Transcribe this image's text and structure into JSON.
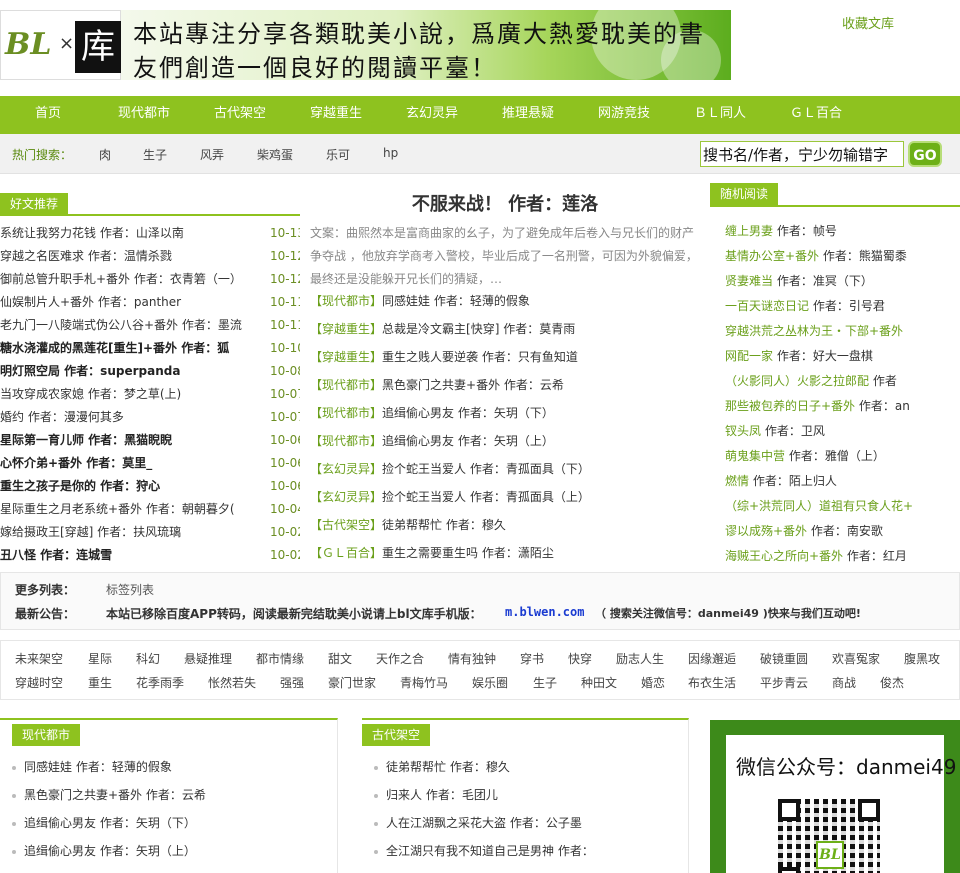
{
  "header": {
    "logo_text": "BL",
    "logo_x": "×",
    "logo_ku": "库",
    "banner_line1": "本站專注分享各類耽美小說，爲廣大熱愛耽美的書",
    "banner_line2": "友們創造一個良好的閱讀平臺！",
    "favorite": "收藏文库"
  },
  "nav": [
    "首页",
    "现代都市",
    "古代架空",
    "穿越重生",
    "玄幻灵异",
    "推理悬疑",
    "网游竞技",
    "ＢＬ同人",
    "ＧＬ百合"
  ],
  "hot_search": {
    "label": "热门搜索：",
    "keywords": [
      "肉",
      "生子",
      "风弄",
      "柴鸡蛋",
      "乐可",
      "hp"
    ]
  },
  "search": {
    "value": "搜书名/作者，宁少勿输错字",
    "button": "GO"
  },
  "left": {
    "tab": "好文推荐",
    "rows": [
      {
        "t": "系统让我努力花钱  作者：山泽以南",
        "d": "10-13",
        "b": false
      },
      {
        "t": "穿越之名医难求  作者：温情杀戮",
        "d": "10-12",
        "b": false
      },
      {
        "t": "御前总管升职手札+番外  作者：衣青箬（一）",
        "d": "10-12",
        "b": false
      },
      {
        "t": "仙娱制片人+番外  作者：panther",
        "d": "10-11",
        "b": false
      },
      {
        "t": "老九门一八陵端式伪公八谷+番外  作者：墨流",
        "d": "10-11",
        "b": false
      },
      {
        "t": "糖水浇灌成的黑莲花[重生]+番外  作者：狐",
        "d": "10-10",
        "b": true
      },
      {
        "t": "明灯照空局  作者：superpanda",
        "d": "10-08",
        "b": true
      },
      {
        "t": "当攻穿成农家媳  作者：梦之草(上)",
        "d": "10-07",
        "b": false
      },
      {
        "t": "婚约  作者：漫漫何其多",
        "d": "10-07",
        "b": false
      },
      {
        "t": "星际第一育儿师  作者：黑猫睨睨",
        "d": "10-06",
        "b": true
      },
      {
        "t": "心怀介弟+番外  作者：莫里_",
        "d": "10-06",
        "b": true
      },
      {
        "t": "重生之孩子是你的  作者：狩心",
        "d": "10-06",
        "b": true
      },
      {
        "t": "星际重生之月老系统+番外  作者：朝朝暮夕(",
        "d": "10-04",
        "b": false
      },
      {
        "t": "嫁给摄政王[穿越]  作者：扶风琉璃",
        "d": "10-02",
        "b": false
      },
      {
        "t": "丑八怪  作者：连城雪",
        "d": "10-02",
        "b": true
      }
    ]
  },
  "center": {
    "title": "不服来战！  作者：莲洛",
    "desc": "文案：曲熙然本是富商曲家的幺子，为了避免成年后卷入与兄长们的财产争夺战 ，他放弃学商考入警校，毕业后成了一名刑警，可因为外貌偏爱，最终还是没能躲开兄长们的猜疑，…",
    "rows": [
      {
        "cat": "【现代都市】",
        "t": "同感娃娃  作者：轻薄的假象"
      },
      {
        "cat": "【穿越重生】",
        "t": "总裁是冷文霸主[快穿]  作者：莫青雨"
      },
      {
        "cat": "【穿越重生】",
        "t": "重生之贱人要逆袭  作者：只有鱼知道"
      },
      {
        "cat": "【现代都市】",
        "t": "黑色豪门之共妻+番外  作者：云希"
      },
      {
        "cat": "【现代都市】",
        "t": "追缉偷心男友  作者：矢玥（下）"
      },
      {
        "cat": "【现代都市】",
        "t": "追缉偷心男友  作者：矢玥（上）"
      },
      {
        "cat": "【玄幻灵异】",
        "t": "捡个蛇王当爱人  作者：青孤面具（下）"
      },
      {
        "cat": "【玄幻灵异】",
        "t": "捡个蛇王当爱人  作者：青孤面具（上）"
      },
      {
        "cat": "【古代架空】",
        "t": "徒弟帮帮忙  作者：穆久"
      },
      {
        "cat": "【ＧＬ百合】",
        "t": "重生之需要重生吗  作者：潇陌尘"
      }
    ]
  },
  "right": {
    "tab": "随机阅读",
    "rows": [
      {
        "t": "缠上男妻",
        "a": "  作者：帧号"
      },
      {
        "t": "基情办公室+番外",
        "a": "  作者：熊猫蜀黍"
      },
      {
        "t": "贤妻难当",
        "a": "  作者：准冥（下）"
      },
      {
        "t": "一百天谜恋日记",
        "a": "  作者：引号君"
      },
      {
        "t": "穿越洪荒之丛林为王・下部+番外",
        "a": ""
      },
      {
        "t": "网配一家",
        "a": "  作者：好大一盘棋"
      },
      {
        "t": "（火影同人）火影之拉郎配",
        "a": "  作者"
      },
      {
        "t": "那些被包养的日子+番外",
        "a": "  作者：an"
      },
      {
        "t": "钗头凤",
        "a": "  作者：卫风"
      },
      {
        "t": "萌鬼集中营",
        "a": "  作者：雅僧（上）"
      },
      {
        "t": "燃情",
        "a": "  作者：陌上归人"
      },
      {
        "t": "（综+洪荒同人）道祖有只食人花+",
        "a": ""
      },
      {
        "t": "谬以成殇+番外",
        "a": "  作者：南安歌"
      },
      {
        "t": "海贼王心之所向+番外",
        "a": "  作者：红月"
      }
    ]
  },
  "notice": {
    "more_label": "更多列表：",
    "more_link": "标签列表",
    "ann_label": "最新公告：",
    "ann_text": "本站已移除百度APP转码，阅读最新完结耽美小说请上bl文库手机版：",
    "ann_url": "m.blwen.com",
    "ann_tail": "（ 搜索关注微信号：danmei49 )快来与我们互动吧!"
  },
  "tags": [
    [
      "未来架空",
      "星际",
      "科幻",
      "悬疑推理",
      "都市情缘",
      "甜文",
      "天作之合",
      "情有独钟",
      "穿书",
      "快穿",
      "励志人生",
      "因缘邂逅",
      "破镜重圆",
      "欢喜冤家",
      "腹黑攻"
    ],
    [
      "穿越时空",
      "重生",
      "花季雨季",
      "怅然若失",
      "强强",
      "豪门世家",
      "青梅竹马",
      "娱乐圈",
      "生子",
      "种田文",
      "婚恋",
      "布衣生活",
      "平步青云",
      "商战",
      "俊杰"
    ]
  ],
  "box1": {
    "tab": "现代都市",
    "rows": [
      "同感娃娃  作者：轻薄的假象",
      "黑色豪门之共妻+番外  作者：云希",
      "追缉偷心男友  作者：矢玥（下）",
      "追缉偷心男友  作者：矢玥（上）"
    ]
  },
  "box2": {
    "tab": "古代架空",
    "rows": [
      "徒弟帮帮忙  作者：穆久",
      "归来人  作者：毛团儿",
      "人在江湖飘之采花大盗  作者：公子墨",
      "全江湖只有我不知道自己是男神  作者："
    ]
  },
  "qr": {
    "text": "微信公众号：danmei49",
    "badge": "BL"
  },
  "colors": {
    "accent": "#8ec21f",
    "dark_accent": "#6a9f1a"
  }
}
